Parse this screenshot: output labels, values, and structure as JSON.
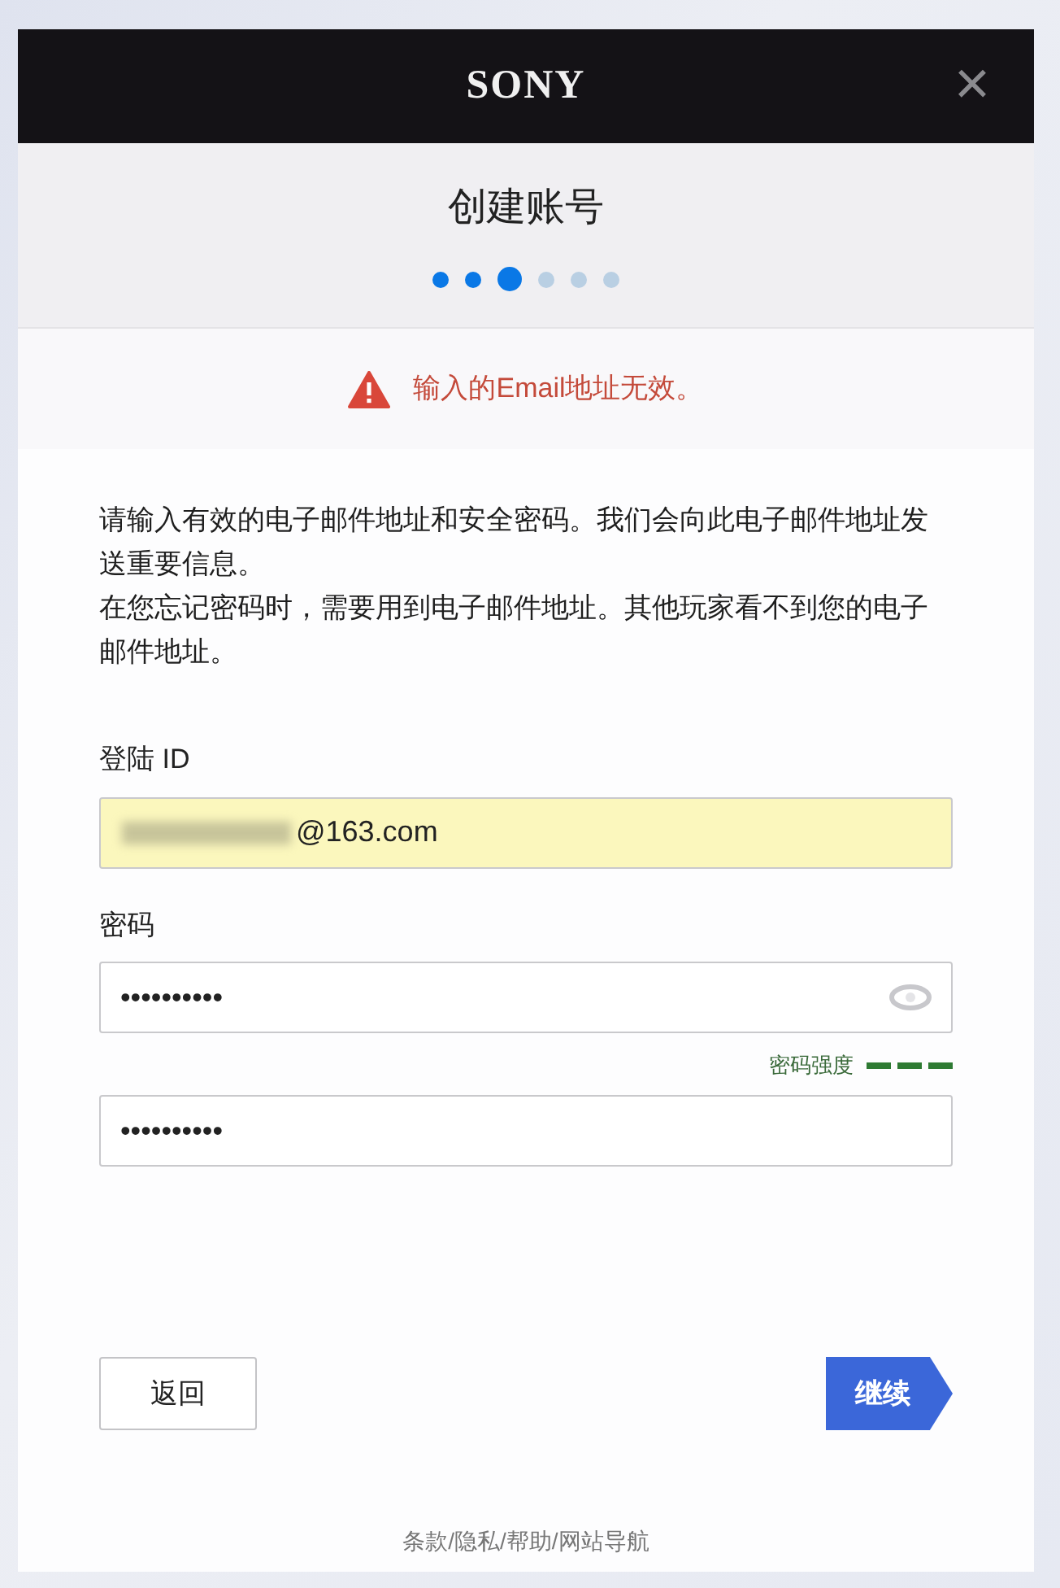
{
  "header": {
    "logo": "SONY",
    "close": "×"
  },
  "title": "创建账号",
  "steps": [
    {
      "completed": true,
      "selected": false
    },
    {
      "completed": true,
      "selected": false
    },
    {
      "completed": true,
      "selected": true
    },
    {
      "completed": false,
      "selected": false
    },
    {
      "completed": false,
      "selected": false
    },
    {
      "completed": false,
      "selected": false
    }
  ],
  "error": "输入的Email地址无效。",
  "intro": [
    "请输入有效的电子邮件地址和安全密码。我们会向此电子邮件地址发送重要信息。",
    "在您忘记密码时，需要用到电子邮件地址。其他玩家看不到您的电子邮件地址。"
  ],
  "login_id": {
    "label": "登陆 ID",
    "value": "@163.com",
    "redacted": true,
    "autofilled": true
  },
  "password": {
    "label": "密码",
    "value": "••••••••••"
  },
  "strength": {
    "label": "密码强度"
  },
  "confirm_password": {
    "value": "••••••••••"
  },
  "buttons": {
    "back": "返回",
    "continue": "继续"
  },
  "footer": "条款/隐私/帮助/网站导航"
}
